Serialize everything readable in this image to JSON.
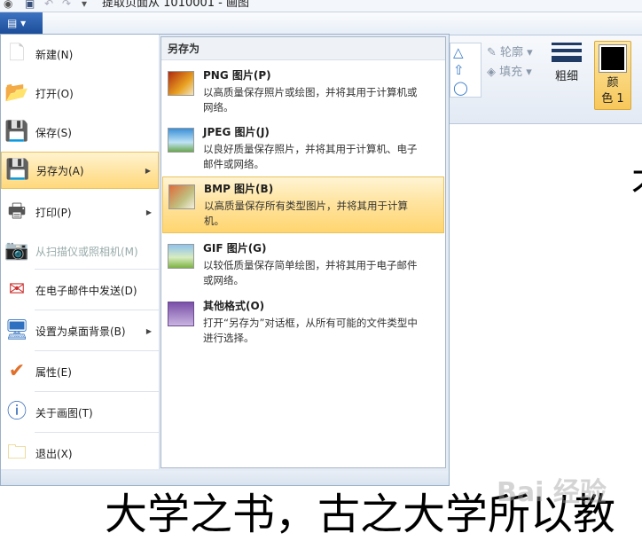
{
  "window": {
    "title": "提取页面从 1010001 - 画图"
  },
  "app_menu_button": "▤ ▾",
  "ribbon": {
    "outline": "轮廓",
    "fill": "填充",
    "thickness": "粗细",
    "color1_line1": "颜",
    "color1_line2": "色 1"
  },
  "menu": {
    "items": [
      {
        "label": "新建(N)",
        "icon": "new-document-icon"
      },
      {
        "label": "打开(O)",
        "icon": "open-folder-icon"
      },
      {
        "label": "保存(S)",
        "icon": "save-icon"
      },
      {
        "label": "另存为(A)",
        "icon": "save-as-icon",
        "submenu": true,
        "highlighted": true
      },
      {
        "label": "打印(P)",
        "icon": "printer-icon",
        "submenu": true
      },
      {
        "label": "从扫描仪或照相机(M)",
        "icon": "scanner-icon",
        "disabled": true
      },
      {
        "label": "在电子邮件中发送(D)",
        "icon": "email-icon"
      },
      {
        "label": "设置为桌面背景(B)",
        "icon": "desktop-icon",
        "submenu": true
      },
      {
        "label": "属性(E)",
        "icon": "checkmark-icon"
      },
      {
        "label": "关于画图(T)",
        "icon": "info-icon"
      },
      {
        "label": "退出(X)",
        "icon": "exit-icon"
      }
    ],
    "submenu": {
      "title": "另存为",
      "formats": [
        {
          "name": "PNG 图片(P)",
          "desc": "以高质量保存照片或绘图，并将其用于计算机或网络。"
        },
        {
          "name": "JPEG 图片(J)",
          "desc": "以良好质量保存照片，并将其用于计算机、电子邮件或网络。"
        },
        {
          "name": "BMP 图片(B)",
          "desc": "以高质量保存所有类型图片，并将其用于计算机。",
          "highlighted": true
        },
        {
          "name": "GIF 图片(G)",
          "desc": "以较低质量保存简单绘图，并将其用于电子邮件或网络。"
        },
        {
          "name": "其他格式(O)",
          "desc": "打开“另存为”对话框，从所有可能的文件类型中进行选择。"
        }
      ]
    }
  },
  "canvas": {
    "text": "大学之书，古之大学所以教",
    "partial_char": "才"
  },
  "watermark": "Bai 经验"
}
